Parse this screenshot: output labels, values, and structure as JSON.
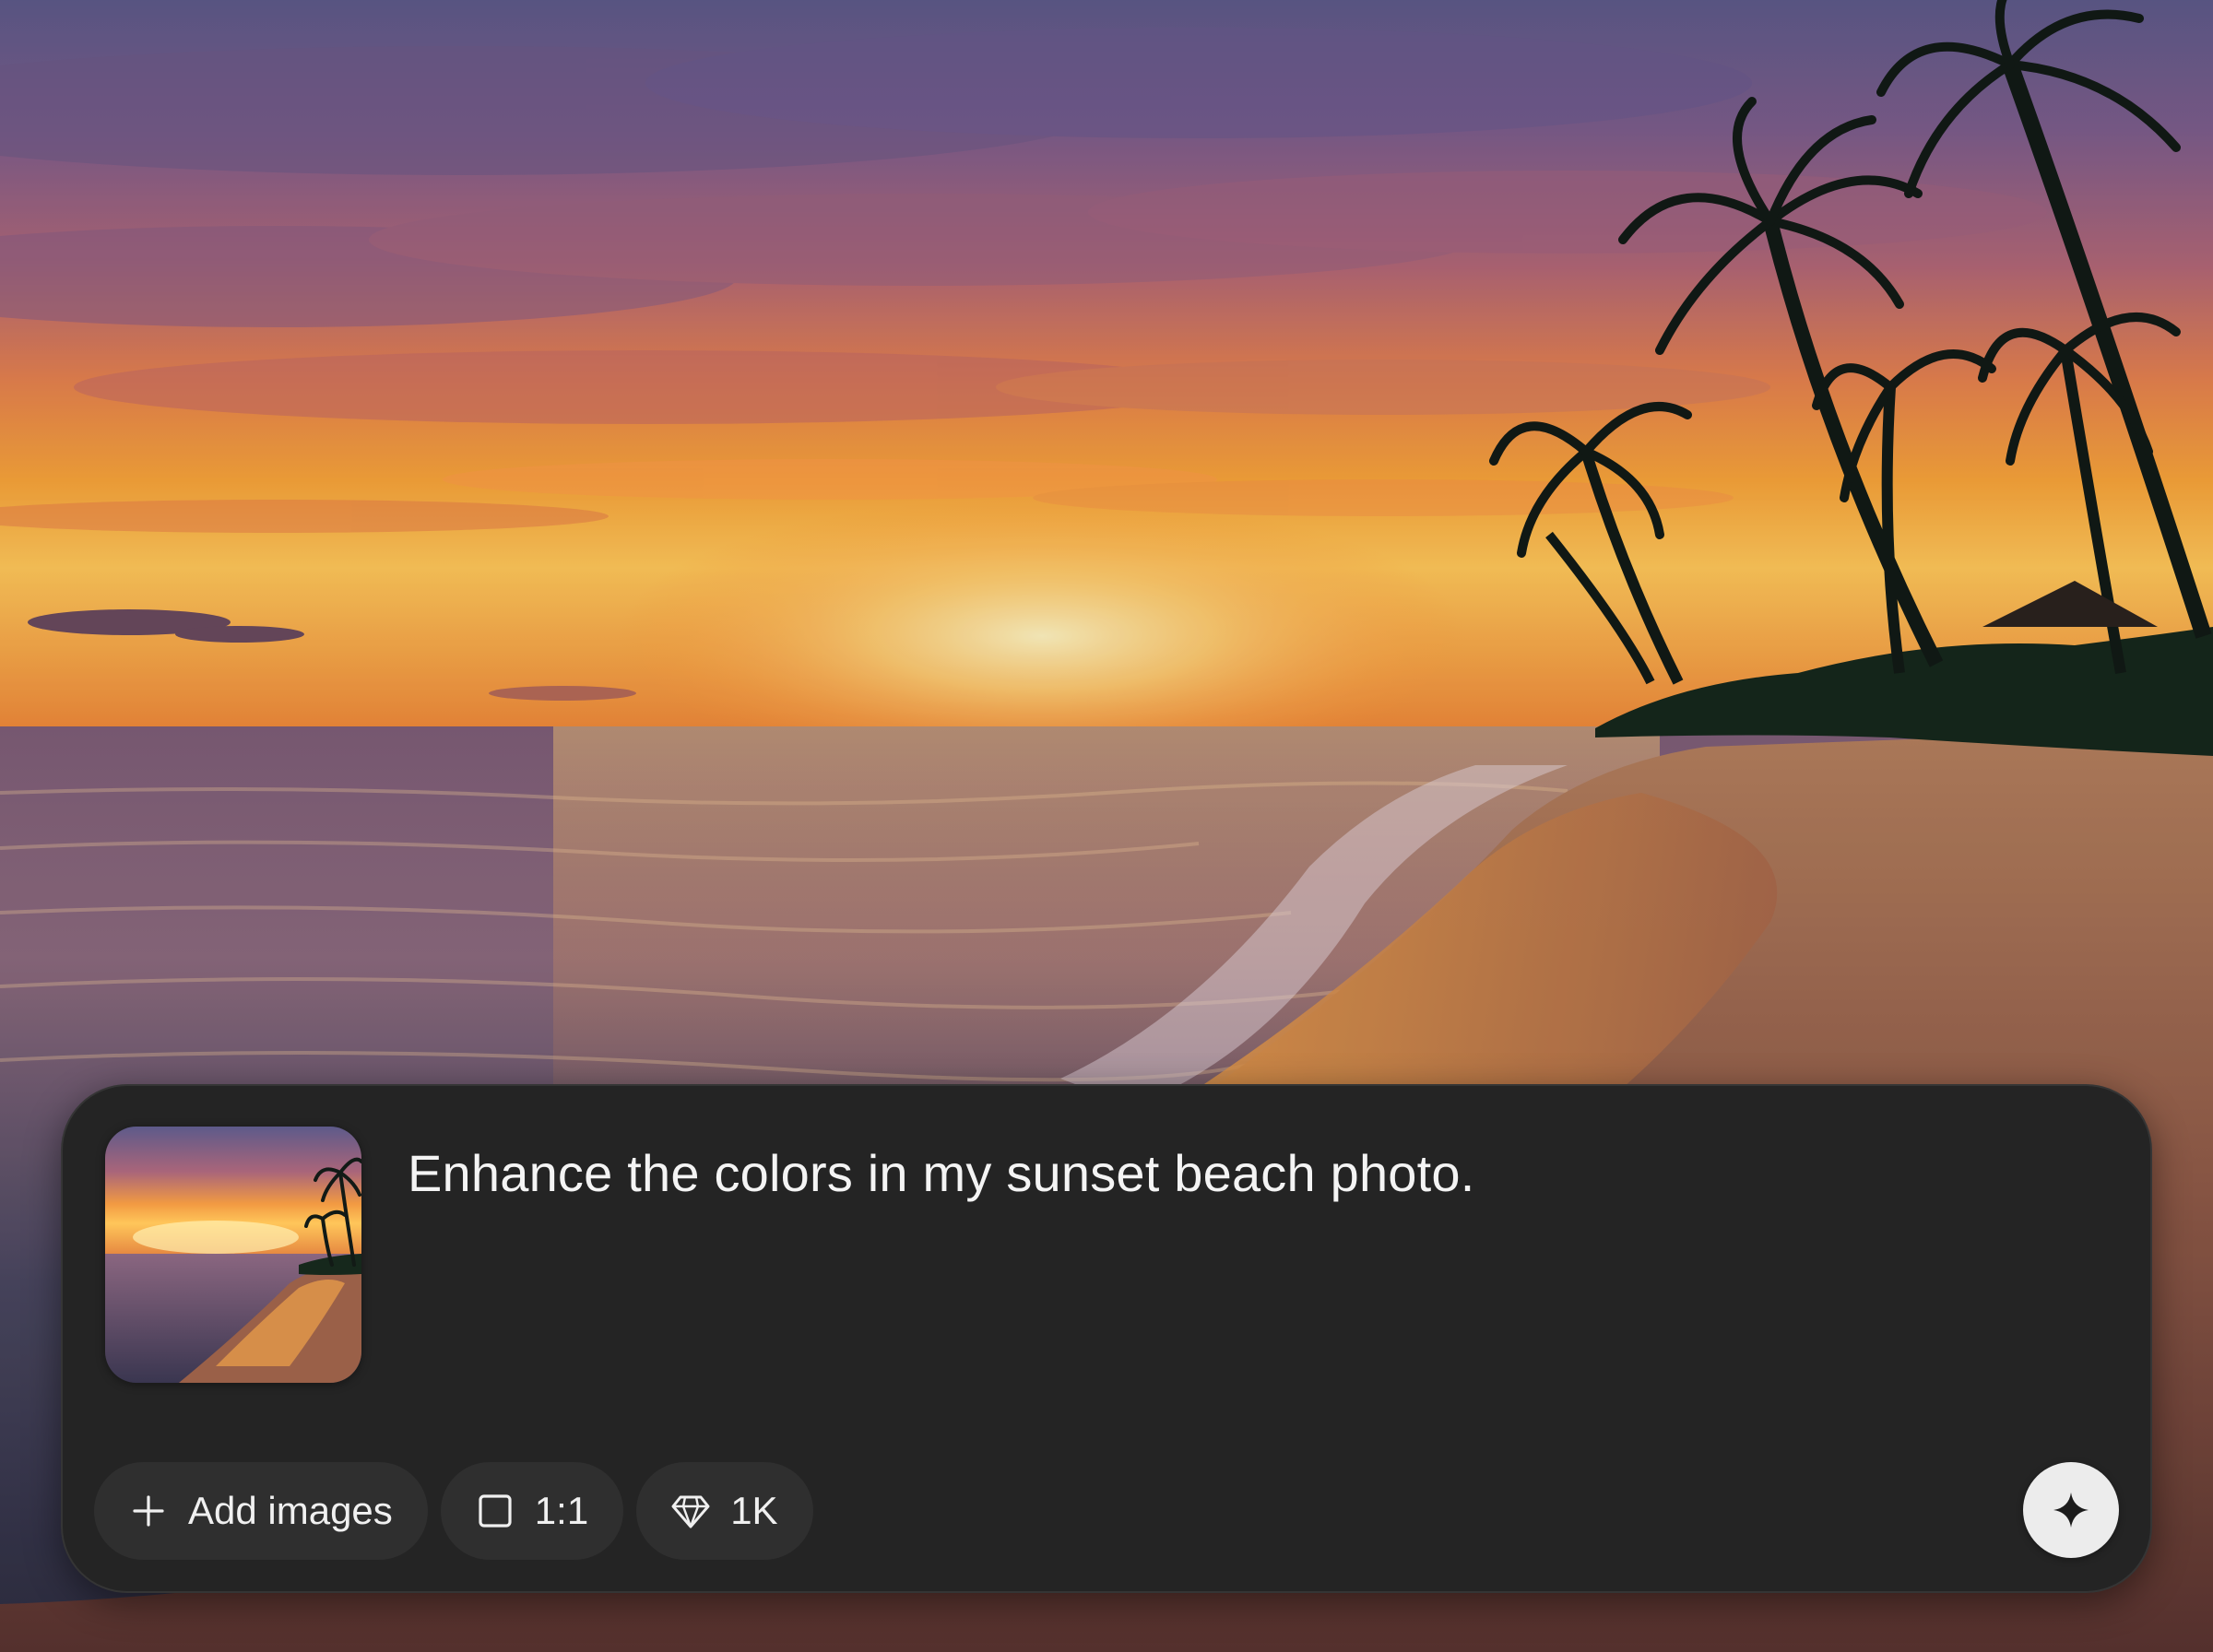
{
  "composer": {
    "prompt_text": "Enhance the colors in my sunset beach photo.",
    "attachment_icon": "image-thumbnail",
    "toolbar": {
      "add_images_label": "Add images",
      "add_images_icon": "plus-icon",
      "aspect_ratio_label": "1:1",
      "aspect_ratio_icon": "square-icon",
      "resolution_label": "1K",
      "resolution_icon": "diamond-icon"
    },
    "generate_icon": "sparkle-icon"
  },
  "colors": {
    "panel": "#242424",
    "chip": "#2f2f2f",
    "text": "#f4f4f4",
    "generate_button": "#ececec"
  }
}
